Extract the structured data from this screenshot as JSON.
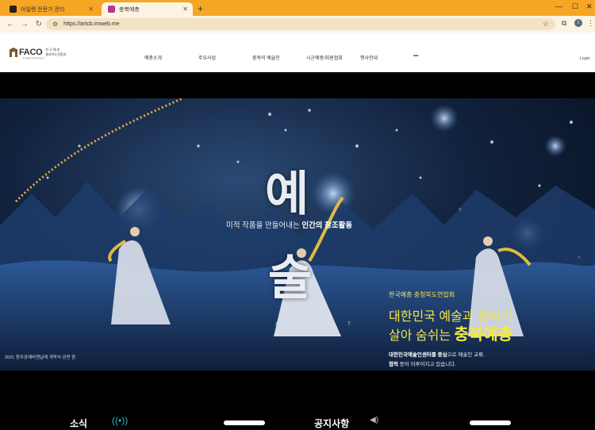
{
  "browser": {
    "tabs": [
      {
        "label": "아일랜 전문가 관리",
        "active": false
      },
      {
        "label": "충북예총",
        "active": true
      }
    ],
    "url": "https://artcb.imweb.me",
    "profile_initial": "t"
  },
  "site": {
    "logo": {
      "text": "FACO",
      "sub1": "한 국 예 총",
      "sub2": "충청북도연합회",
      "tiny": "한국예술문화단체총연합회"
    },
    "nav": [
      "예총소개",
      "주요사업",
      "충북의 예술인",
      "시군예총/회원협회",
      "행사안내",
      "•••"
    ],
    "login": "Login"
  },
  "hero": {
    "big1": "예",
    "big2": "술",
    "art_letters": "A R T",
    "subcopy_plain": "미적 작품을 만들어내는 ",
    "subcopy_bold": "인간의 창조활동",
    "caption": "2021 청주공예비엔날레 개막식 공연 중",
    "kicker_plain": "한국예총 ",
    "kicker_hl": "충청북도연합회",
    "headline1": "대한민국 예술과 문화가",
    "headline2_plain": "살아 숨쉬는 ",
    "headline2_bold": "충북예총",
    "desc1_bold": "대한민국예술인센터를 중심",
    "desc1_plain": "으로 예술인 교류,",
    "desc2_bold": "협력",
    "desc2_plain": " 등이 이루어지고 있습니다."
  },
  "below": {
    "left_title": "소식",
    "right_title": "공지사항"
  },
  "colors": {
    "chrome_accent": "#f5a623",
    "headline_yellow": "#f2e24c",
    "broadcast_teal": "#2bb7c9"
  }
}
